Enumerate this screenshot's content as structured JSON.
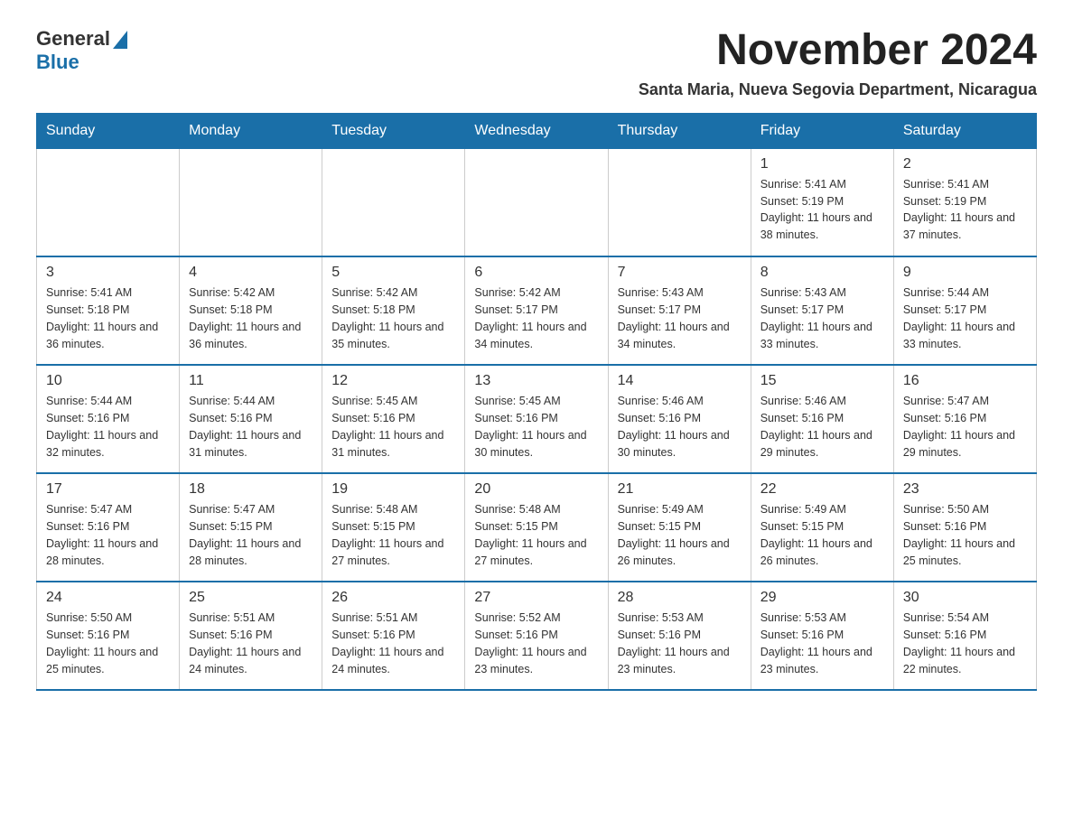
{
  "header": {
    "logo_general": "General",
    "logo_blue": "Blue",
    "month_title": "November 2024",
    "subtitle": "Santa Maria, Nueva Segovia Department, Nicaragua"
  },
  "calendar": {
    "days_of_week": [
      "Sunday",
      "Monday",
      "Tuesday",
      "Wednesday",
      "Thursday",
      "Friday",
      "Saturday"
    ],
    "weeks": [
      [
        {
          "day": "",
          "info": ""
        },
        {
          "day": "",
          "info": ""
        },
        {
          "day": "",
          "info": ""
        },
        {
          "day": "",
          "info": ""
        },
        {
          "day": "",
          "info": ""
        },
        {
          "day": "1",
          "info": "Sunrise: 5:41 AM\nSunset: 5:19 PM\nDaylight: 11 hours and 38 minutes."
        },
        {
          "day": "2",
          "info": "Sunrise: 5:41 AM\nSunset: 5:19 PM\nDaylight: 11 hours and 37 minutes."
        }
      ],
      [
        {
          "day": "3",
          "info": "Sunrise: 5:41 AM\nSunset: 5:18 PM\nDaylight: 11 hours and 36 minutes."
        },
        {
          "day": "4",
          "info": "Sunrise: 5:42 AM\nSunset: 5:18 PM\nDaylight: 11 hours and 36 minutes."
        },
        {
          "day": "5",
          "info": "Sunrise: 5:42 AM\nSunset: 5:18 PM\nDaylight: 11 hours and 35 minutes."
        },
        {
          "day": "6",
          "info": "Sunrise: 5:42 AM\nSunset: 5:17 PM\nDaylight: 11 hours and 34 minutes."
        },
        {
          "day": "7",
          "info": "Sunrise: 5:43 AM\nSunset: 5:17 PM\nDaylight: 11 hours and 34 minutes."
        },
        {
          "day": "8",
          "info": "Sunrise: 5:43 AM\nSunset: 5:17 PM\nDaylight: 11 hours and 33 minutes."
        },
        {
          "day": "9",
          "info": "Sunrise: 5:44 AM\nSunset: 5:17 PM\nDaylight: 11 hours and 33 minutes."
        }
      ],
      [
        {
          "day": "10",
          "info": "Sunrise: 5:44 AM\nSunset: 5:16 PM\nDaylight: 11 hours and 32 minutes."
        },
        {
          "day": "11",
          "info": "Sunrise: 5:44 AM\nSunset: 5:16 PM\nDaylight: 11 hours and 31 minutes."
        },
        {
          "day": "12",
          "info": "Sunrise: 5:45 AM\nSunset: 5:16 PM\nDaylight: 11 hours and 31 minutes."
        },
        {
          "day": "13",
          "info": "Sunrise: 5:45 AM\nSunset: 5:16 PM\nDaylight: 11 hours and 30 minutes."
        },
        {
          "day": "14",
          "info": "Sunrise: 5:46 AM\nSunset: 5:16 PM\nDaylight: 11 hours and 30 minutes."
        },
        {
          "day": "15",
          "info": "Sunrise: 5:46 AM\nSunset: 5:16 PM\nDaylight: 11 hours and 29 minutes."
        },
        {
          "day": "16",
          "info": "Sunrise: 5:47 AM\nSunset: 5:16 PM\nDaylight: 11 hours and 29 minutes."
        }
      ],
      [
        {
          "day": "17",
          "info": "Sunrise: 5:47 AM\nSunset: 5:16 PM\nDaylight: 11 hours and 28 minutes."
        },
        {
          "day": "18",
          "info": "Sunrise: 5:47 AM\nSunset: 5:15 PM\nDaylight: 11 hours and 28 minutes."
        },
        {
          "day": "19",
          "info": "Sunrise: 5:48 AM\nSunset: 5:15 PM\nDaylight: 11 hours and 27 minutes."
        },
        {
          "day": "20",
          "info": "Sunrise: 5:48 AM\nSunset: 5:15 PM\nDaylight: 11 hours and 27 minutes."
        },
        {
          "day": "21",
          "info": "Sunrise: 5:49 AM\nSunset: 5:15 PM\nDaylight: 11 hours and 26 minutes."
        },
        {
          "day": "22",
          "info": "Sunrise: 5:49 AM\nSunset: 5:15 PM\nDaylight: 11 hours and 26 minutes."
        },
        {
          "day": "23",
          "info": "Sunrise: 5:50 AM\nSunset: 5:16 PM\nDaylight: 11 hours and 25 minutes."
        }
      ],
      [
        {
          "day": "24",
          "info": "Sunrise: 5:50 AM\nSunset: 5:16 PM\nDaylight: 11 hours and 25 minutes."
        },
        {
          "day": "25",
          "info": "Sunrise: 5:51 AM\nSunset: 5:16 PM\nDaylight: 11 hours and 24 minutes."
        },
        {
          "day": "26",
          "info": "Sunrise: 5:51 AM\nSunset: 5:16 PM\nDaylight: 11 hours and 24 minutes."
        },
        {
          "day": "27",
          "info": "Sunrise: 5:52 AM\nSunset: 5:16 PM\nDaylight: 11 hours and 23 minutes."
        },
        {
          "day": "28",
          "info": "Sunrise: 5:53 AM\nSunset: 5:16 PM\nDaylight: 11 hours and 23 minutes."
        },
        {
          "day": "29",
          "info": "Sunrise: 5:53 AM\nSunset: 5:16 PM\nDaylight: 11 hours and 23 minutes."
        },
        {
          "day": "30",
          "info": "Sunrise: 5:54 AM\nSunset: 5:16 PM\nDaylight: 11 hours and 22 minutes."
        }
      ]
    ]
  }
}
